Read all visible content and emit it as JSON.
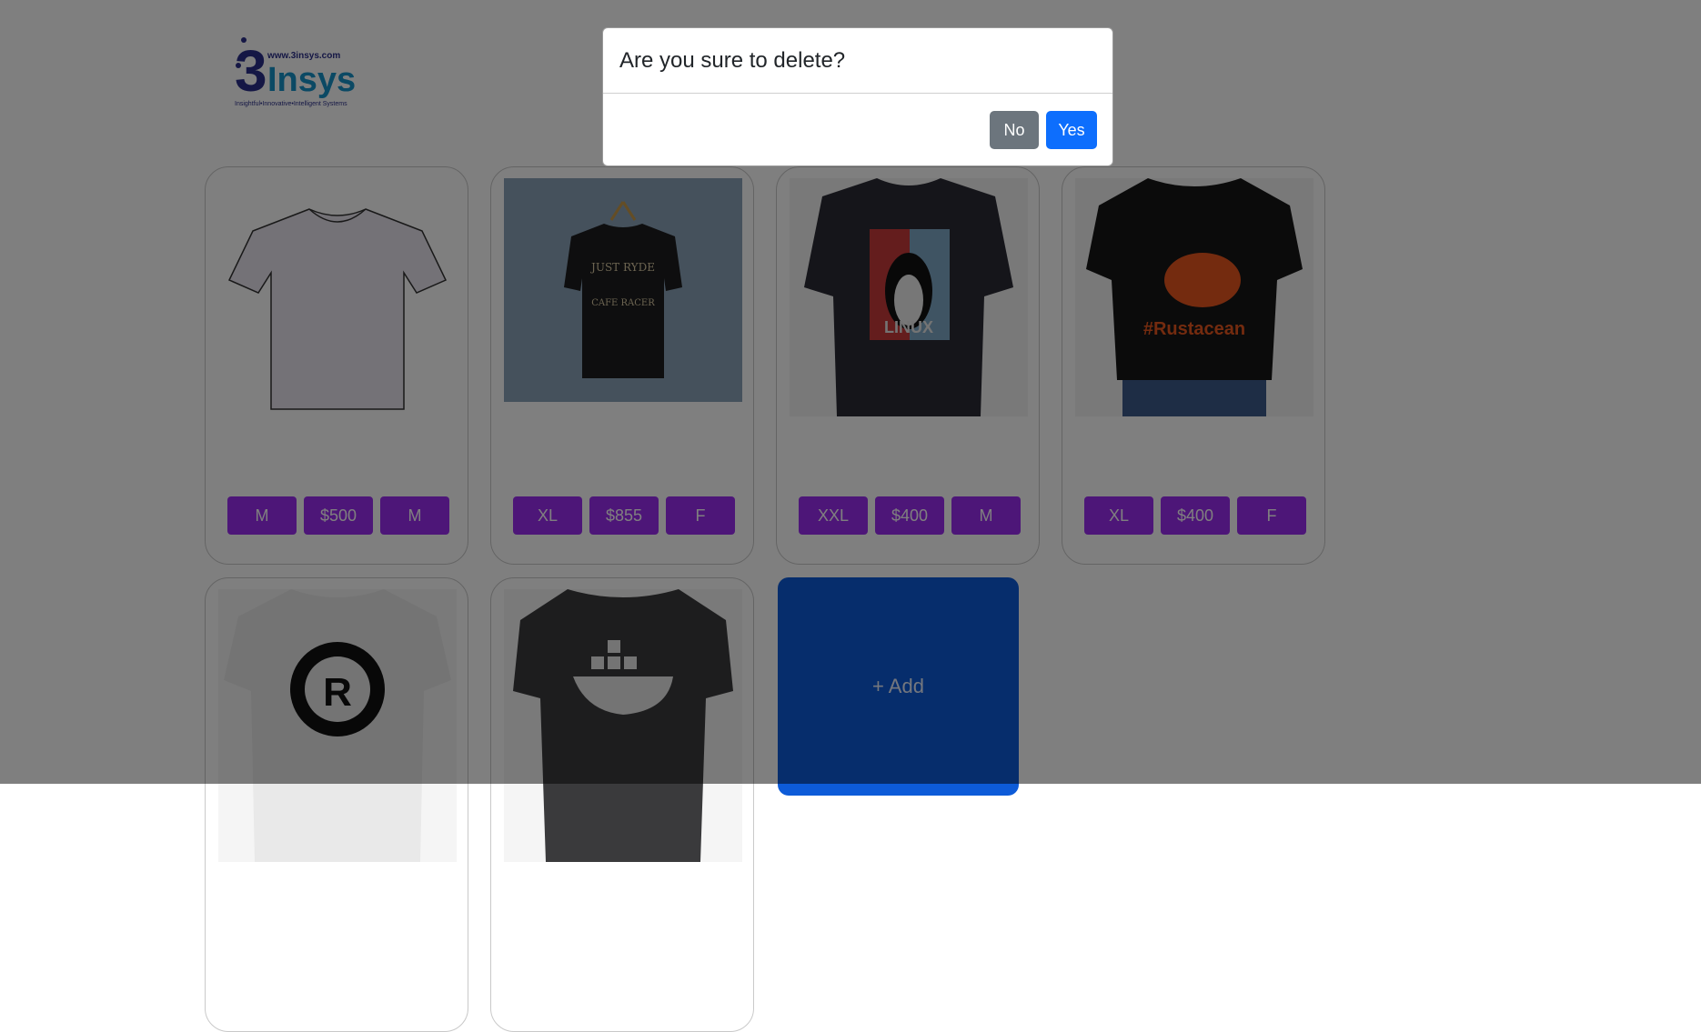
{
  "logo": {
    "numeral": "3",
    "word": "Insys",
    "url": "www.3insys.com",
    "tagline": "Insightful•Innovative•Intelligent Systems"
  },
  "products": [
    {
      "image": "blank-tshirt-drawing",
      "size": "M",
      "price": "$500",
      "gender": "M"
    },
    {
      "image": "black-tshirt-hanger-just-ryde-cafe-racer",
      "size": "XL",
      "price": "$855",
      "gender": "F"
    },
    {
      "image": "linux-penguin-tshirt",
      "size": "XXL",
      "price": "$400",
      "gender": "M"
    },
    {
      "image": "rustacean-crab-tshirt",
      "size": "XL",
      "price": "$400",
      "gender": "F"
    },
    {
      "image": "rust-logo-tshirt"
    },
    {
      "image": "docker-whale-tshirt"
    }
  ],
  "tshirt_prints": {
    "hanger_line1": "JUST RYDE",
    "hanger_line2": "CAFE RACER",
    "linux": "LINUX",
    "rustacean": "#Rustacean",
    "rust_letter": "R"
  },
  "add_card": {
    "label": "+ Add"
  },
  "modal": {
    "title": "Are you sure to delete?",
    "no_label": "No",
    "yes_label": "Yes"
  },
  "colors": {
    "product_button": "#9b2df0",
    "add_card": "#0d5bd8",
    "modal_no": "#6c757d",
    "modal_yes": "#0d6efd",
    "backdrop": "rgba(0,0,0,0.5)"
  }
}
